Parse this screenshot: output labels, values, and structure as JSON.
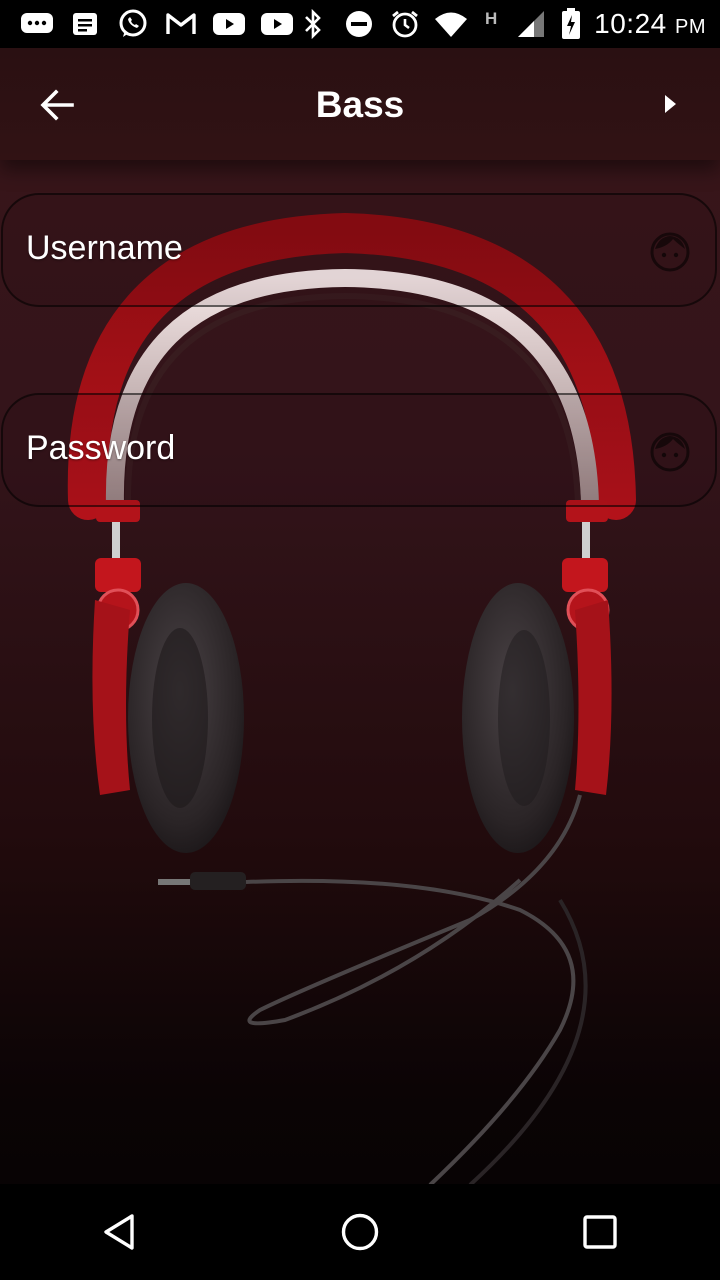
{
  "status_bar": {
    "time": "10:24",
    "ampm": "PM",
    "network_label": "H",
    "icons": [
      "chat-icon",
      "message-icon",
      "whatsapp-icon",
      "gmail-icon",
      "youtube-icon",
      "youtube-icon",
      "bluetooth-icon",
      "do-not-disturb-icon",
      "alarm-icon",
      "wifi-icon",
      "signal-icon",
      "battery-icon"
    ]
  },
  "app_bar": {
    "title": "Bass",
    "back_icon": "arrow-back-icon",
    "next_icon": "play-arrow-icon"
  },
  "form": {
    "username_label": "Username",
    "password_label": "Password",
    "field_icon": "face-icon"
  },
  "nav_bar": {
    "icons": [
      "back-triangle-icon",
      "home-circle-icon",
      "recents-square-icon"
    ]
  },
  "colors": {
    "accent_red": "#c0121a",
    "background_top": "#3a1619",
    "background_bottom": "#040203"
  }
}
